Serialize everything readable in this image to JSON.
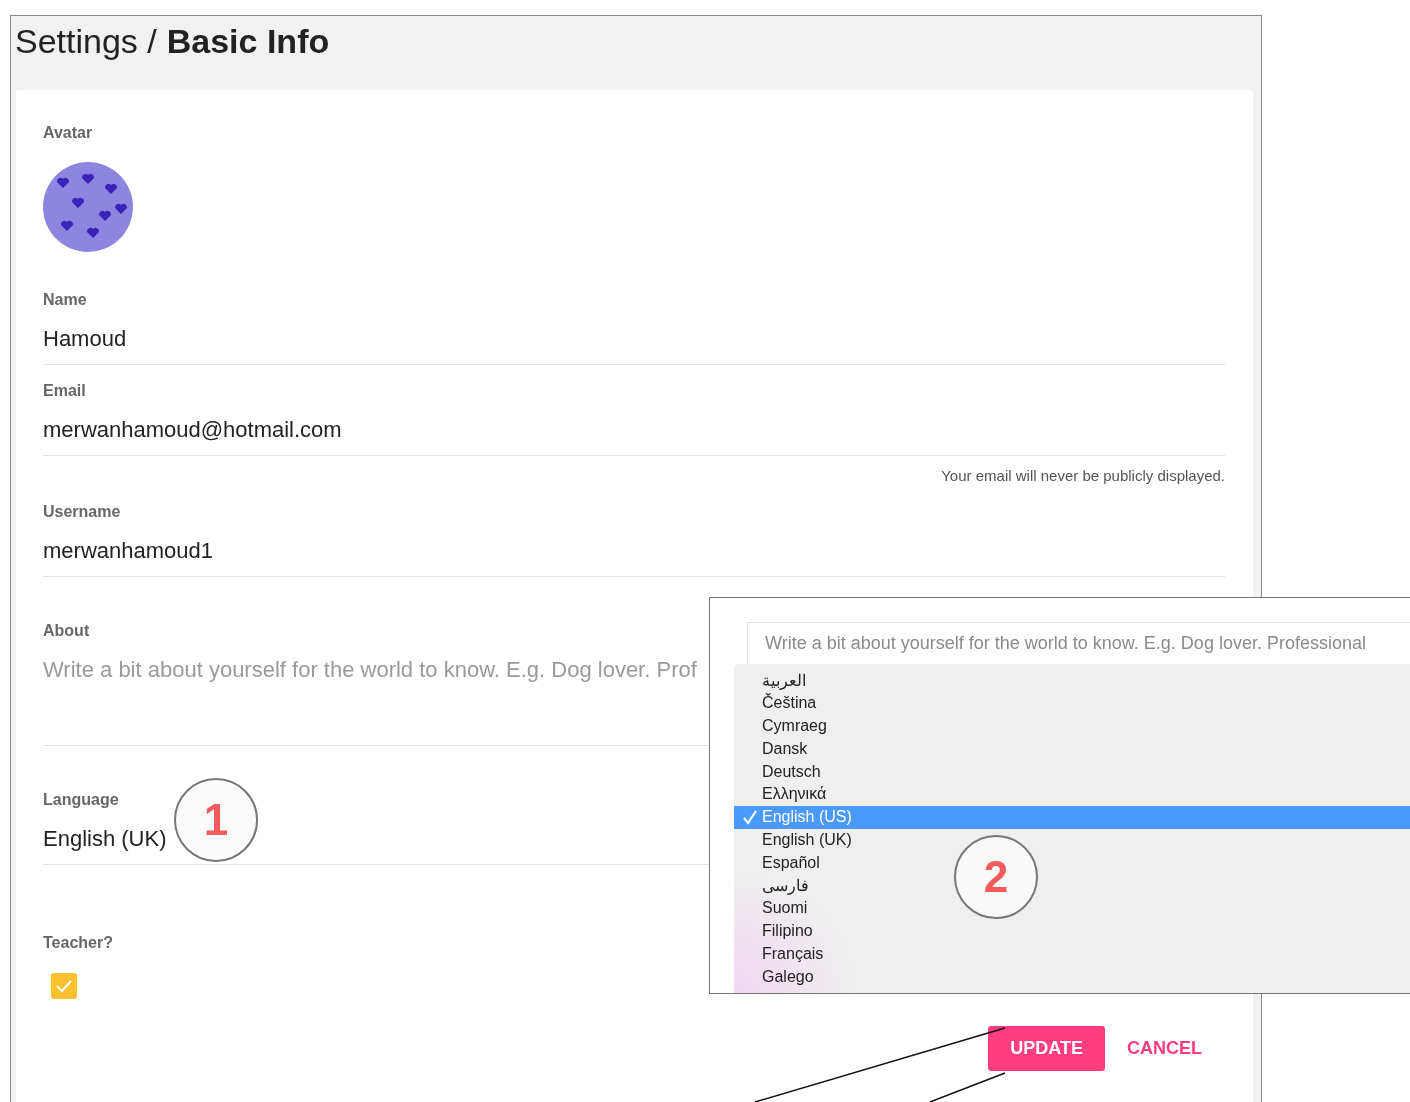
{
  "page": {
    "breadcrumb": "Settings /",
    "title": "Basic Info"
  },
  "avatar": {
    "label": "Avatar"
  },
  "fields": [
    {
      "kind": "text",
      "label": "Name",
      "value": "Hamoud"
    },
    {
      "kind": "text",
      "label": "Email",
      "value": "merwanhamoud@hotmail.com",
      "hint": "Your email will never be publicly displayed."
    },
    {
      "kind": "text",
      "label": "Username",
      "value": "merwanhamoud1"
    },
    {
      "kind": "textarea",
      "label": "About",
      "placeholder": "Write a bit about yourself for the world to know. E.g. Dog lover. Prof"
    },
    {
      "kind": "select",
      "label": "Language",
      "value": "English (UK)"
    },
    {
      "kind": "checkbox",
      "label": "Teacher?",
      "checked": true
    }
  ],
  "buttons": [
    {
      "kind": "primary",
      "label": "UPDATE"
    },
    {
      "kind": "flat",
      "label": "CANCEL"
    }
  ],
  "inset": {
    "placeholder": "Write a bit about yourself for the world to know. E.g. Dog lover. Professional",
    "options": [
      {
        "label": "العربية",
        "selected": false
      },
      {
        "label": "Čeština",
        "selected": false
      },
      {
        "label": "Cymraeg",
        "selected": false
      },
      {
        "label": "Dansk",
        "selected": false
      },
      {
        "label": "Deutsch",
        "selected": false
      },
      {
        "label": "Ελληνικά",
        "selected": false
      },
      {
        "label": "English (US)",
        "selected": true
      },
      {
        "label": "English (UK)",
        "selected": false
      },
      {
        "label": "Español",
        "selected": false
      },
      {
        "label": "فارسی",
        "selected": false
      },
      {
        "label": "Suomi",
        "selected": false
      },
      {
        "label": "Filipino",
        "selected": false
      },
      {
        "label": "Français",
        "selected": false
      },
      {
        "label": "Galego",
        "selected": false
      }
    ]
  },
  "callouts": [
    {
      "number": "1"
    },
    {
      "number": "2"
    }
  ]
}
